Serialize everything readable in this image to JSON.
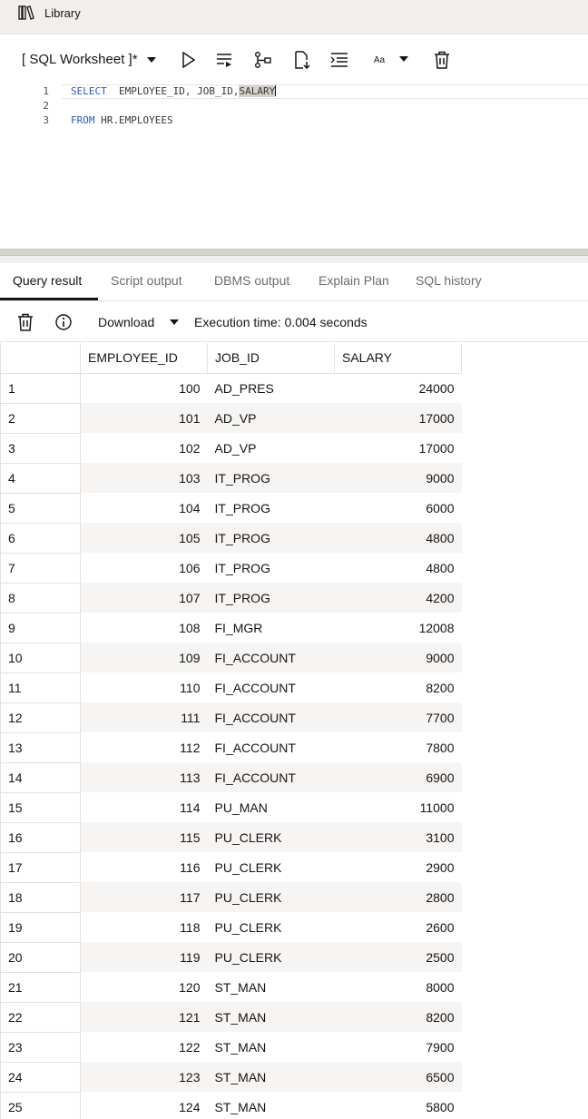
{
  "topbar": {
    "library_label": "Library",
    "library_icon": "books-icon"
  },
  "toolbar": {
    "worksheet_title": "[ SQL Worksheet ]*",
    "icons": [
      "run-icon",
      "run-script-icon",
      "explain-plan-icon",
      "download-script-icon",
      "format-icon",
      "font-size-icon",
      "clear-icon"
    ],
    "font_label": "Aa"
  },
  "editor": {
    "line_numbers": [
      "1",
      "2",
      "3"
    ],
    "line1_keyword": "SELECT",
    "line1_rest": "  EMPLOYEE_ID, JOB_ID,",
    "line1_selected": "SALARY",
    "line3_keyword": "FROM",
    "line3_rest": " HR.EMPLOYEES"
  },
  "tabs": [
    {
      "label": "Query result",
      "active": true
    },
    {
      "label": "Script output",
      "active": false
    },
    {
      "label": "DBMS output",
      "active": false
    },
    {
      "label": "Explain Plan",
      "active": false
    },
    {
      "label": "SQL history",
      "active": false
    }
  ],
  "result_toolbar": {
    "download_label": "Download",
    "execution_time": "Execution time: 0.004 seconds",
    "icons": [
      "trash-icon",
      "info-icon"
    ]
  },
  "table": {
    "columns": [
      "",
      "EMPLOYEE_ID",
      "JOB_ID",
      "SALARY"
    ],
    "rows": [
      [
        "1",
        "100",
        "AD_PRES",
        "24000"
      ],
      [
        "2",
        "101",
        "AD_VP",
        "17000"
      ],
      [
        "3",
        "102",
        "AD_VP",
        "17000"
      ],
      [
        "4",
        "103",
        "IT_PROG",
        "9000"
      ],
      [
        "5",
        "104",
        "IT_PROG",
        "6000"
      ],
      [
        "6",
        "105",
        "IT_PROG",
        "4800"
      ],
      [
        "7",
        "106",
        "IT_PROG",
        "4800"
      ],
      [
        "8",
        "107",
        "IT_PROG",
        "4200"
      ],
      [
        "9",
        "108",
        "FI_MGR",
        "12008"
      ],
      [
        "10",
        "109",
        "FI_ACCOUNT",
        "9000"
      ],
      [
        "11",
        "110",
        "FI_ACCOUNT",
        "8200"
      ],
      [
        "12",
        "111",
        "FI_ACCOUNT",
        "7700"
      ],
      [
        "13",
        "112",
        "FI_ACCOUNT",
        "7800"
      ],
      [
        "14",
        "113",
        "FI_ACCOUNT",
        "6900"
      ],
      [
        "15",
        "114",
        "PU_MAN",
        "11000"
      ],
      [
        "16",
        "115",
        "PU_CLERK",
        "3100"
      ],
      [
        "17",
        "116",
        "PU_CLERK",
        "2900"
      ],
      [
        "18",
        "117",
        "PU_CLERK",
        "2800"
      ],
      [
        "19",
        "118",
        "PU_CLERK",
        "2600"
      ],
      [
        "20",
        "119",
        "PU_CLERK",
        "2500"
      ],
      [
        "21",
        "120",
        "ST_MAN",
        "8000"
      ],
      [
        "22",
        "121",
        "ST_MAN",
        "8200"
      ],
      [
        "23",
        "122",
        "ST_MAN",
        "7900"
      ],
      [
        "24",
        "123",
        "ST_MAN",
        "6500"
      ],
      [
        "25",
        "124",
        "ST_MAN",
        "5800"
      ]
    ]
  }
}
